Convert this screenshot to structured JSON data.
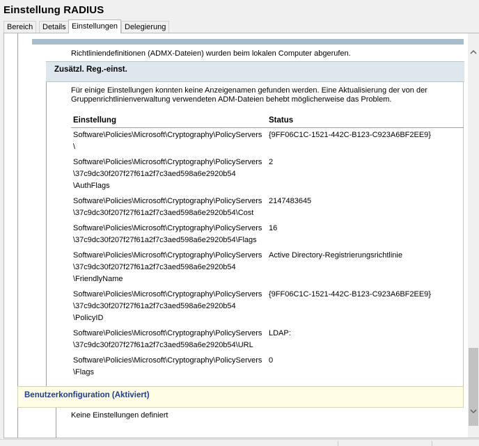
{
  "window": {
    "title": "Einstellung RADIUS"
  },
  "tabs": [
    {
      "label": "Bereich"
    },
    {
      "label": "Details"
    },
    {
      "label": "Einstellungen"
    },
    {
      "label": "Delegierung"
    }
  ],
  "content": {
    "admx_note": "Richtliniendefinitionen (ADMX-Dateien) wurden beim lokalen Computer abgerufen.",
    "section_title": "Zusätzl. Reg.-einst.",
    "info_line1": "Für einige Einstellungen konnten keine Anzeigenamen gefunden werden. Eine Aktualisierung der von der",
    "info_line2": "Gruppenrichtlinienverwaltung verwendeten ADM-Dateien behebt möglicherweise das Problem.",
    "table": {
      "headers": {
        "setting": "Einstellung",
        "status": "Status"
      },
      "rows": [
        {
          "setting_lines": [
            "Software\\Policies\\Microsoft\\Cryptography\\PolicyServers",
            "\\"
          ],
          "status": "{9FF06C1C-1521-442C-B123-C923A6BF2EE9}"
        },
        {
          "setting_lines": [
            "Software\\Policies\\Microsoft\\Cryptography\\PolicyServers",
            "\\37c9dc30f207f27f61a2f7c3aed598a6e2920b54",
            "\\AuthFlags"
          ],
          "status": "2"
        },
        {
          "setting_lines": [
            "Software\\Policies\\Microsoft\\Cryptography\\PolicyServers",
            "\\37c9dc30f207f27f61a2f7c3aed598a6e2920b54\\Cost"
          ],
          "status": "2147483645"
        },
        {
          "setting_lines": [
            "Software\\Policies\\Microsoft\\Cryptography\\PolicyServers",
            "\\37c9dc30f207f27f61a2f7c3aed598a6e2920b54\\Flags"
          ],
          "status": "16"
        },
        {
          "setting_lines": [
            "Software\\Policies\\Microsoft\\Cryptography\\PolicyServers",
            "\\37c9dc30f207f27f61a2f7c3aed598a6e2920b54",
            "\\FriendlyName"
          ],
          "status": "Active Directory-Registrierungsrichtlinie"
        },
        {
          "setting_lines": [
            "Software\\Policies\\Microsoft\\Cryptography\\PolicyServers",
            "\\37c9dc30f207f27f61a2f7c3aed598a6e2920b54",
            "\\PolicyID"
          ],
          "status": "{9FF06C1C-1521-442C-B123-C923A6BF2EE9}"
        },
        {
          "setting_lines": [
            "Software\\Policies\\Microsoft\\Cryptography\\PolicyServers",
            "\\37c9dc30f207f27f61a2f7c3aed598a6e2920b54\\URL"
          ],
          "status": "LDAP:"
        },
        {
          "setting_lines": [
            "Software\\Policies\\Microsoft\\Cryptography\\PolicyServers",
            "\\Flags"
          ],
          "status": "0"
        }
      ]
    },
    "user_config_title": "Benutzerkonfiguration (Aktiviert)",
    "no_settings": "Keine Einstellungen definiert"
  },
  "icons": {
    "scroll_up": "chevron-up-icon",
    "scroll_down": "chevron-down-icon"
  },
  "colors": {
    "section_bg": "#dee7ec",
    "header_band": "#a9bccb",
    "user_config_bg": "#fffde6",
    "user_config_text": "#1f3d8a"
  }
}
